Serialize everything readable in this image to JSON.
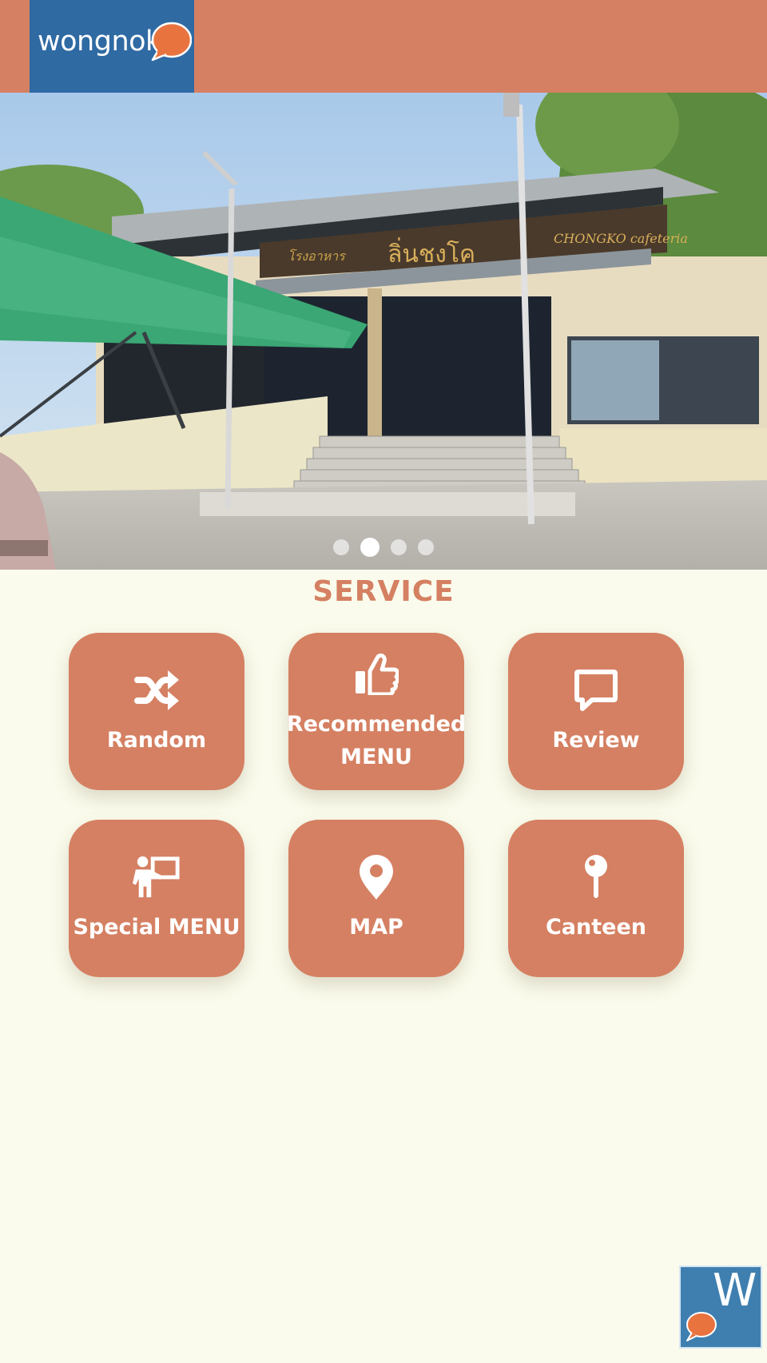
{
  "header": {
    "logo_text": "wongnok",
    "logo_icon": "speech-bubble-icon",
    "colors": {
      "bar": "#d58062",
      "logo_bg": "#2f6aa3",
      "bubble": "#e8733f"
    }
  },
  "hero": {
    "sign_thai_left": "โรงอาหาร",
    "sign_thai_main": "ลิ่นชงโค",
    "sign_english": "CHONGKO cafeteria",
    "slide_count": 4,
    "active_slide": 2
  },
  "service": {
    "title": "SERVICE",
    "tiles": [
      {
        "label": "Random",
        "icon": "shuffle-icon"
      },
      {
        "label": "Recommended\nMENU",
        "icon": "thumbs-up-icon"
      },
      {
        "label": "Review",
        "icon": "comment-icon"
      },
      {
        "label": "Special MENU",
        "icon": "person-presenting-icon"
      },
      {
        "label": "MAP",
        "icon": "location-pin-icon"
      },
      {
        "label": "Canteen",
        "icon": "map-pin-icon"
      }
    ],
    "colors": {
      "tile": "#d58062",
      "title": "#d58062",
      "background": "#fafbec"
    }
  },
  "fab": {
    "letter": "W",
    "icon": "wongnok-app-icon"
  }
}
